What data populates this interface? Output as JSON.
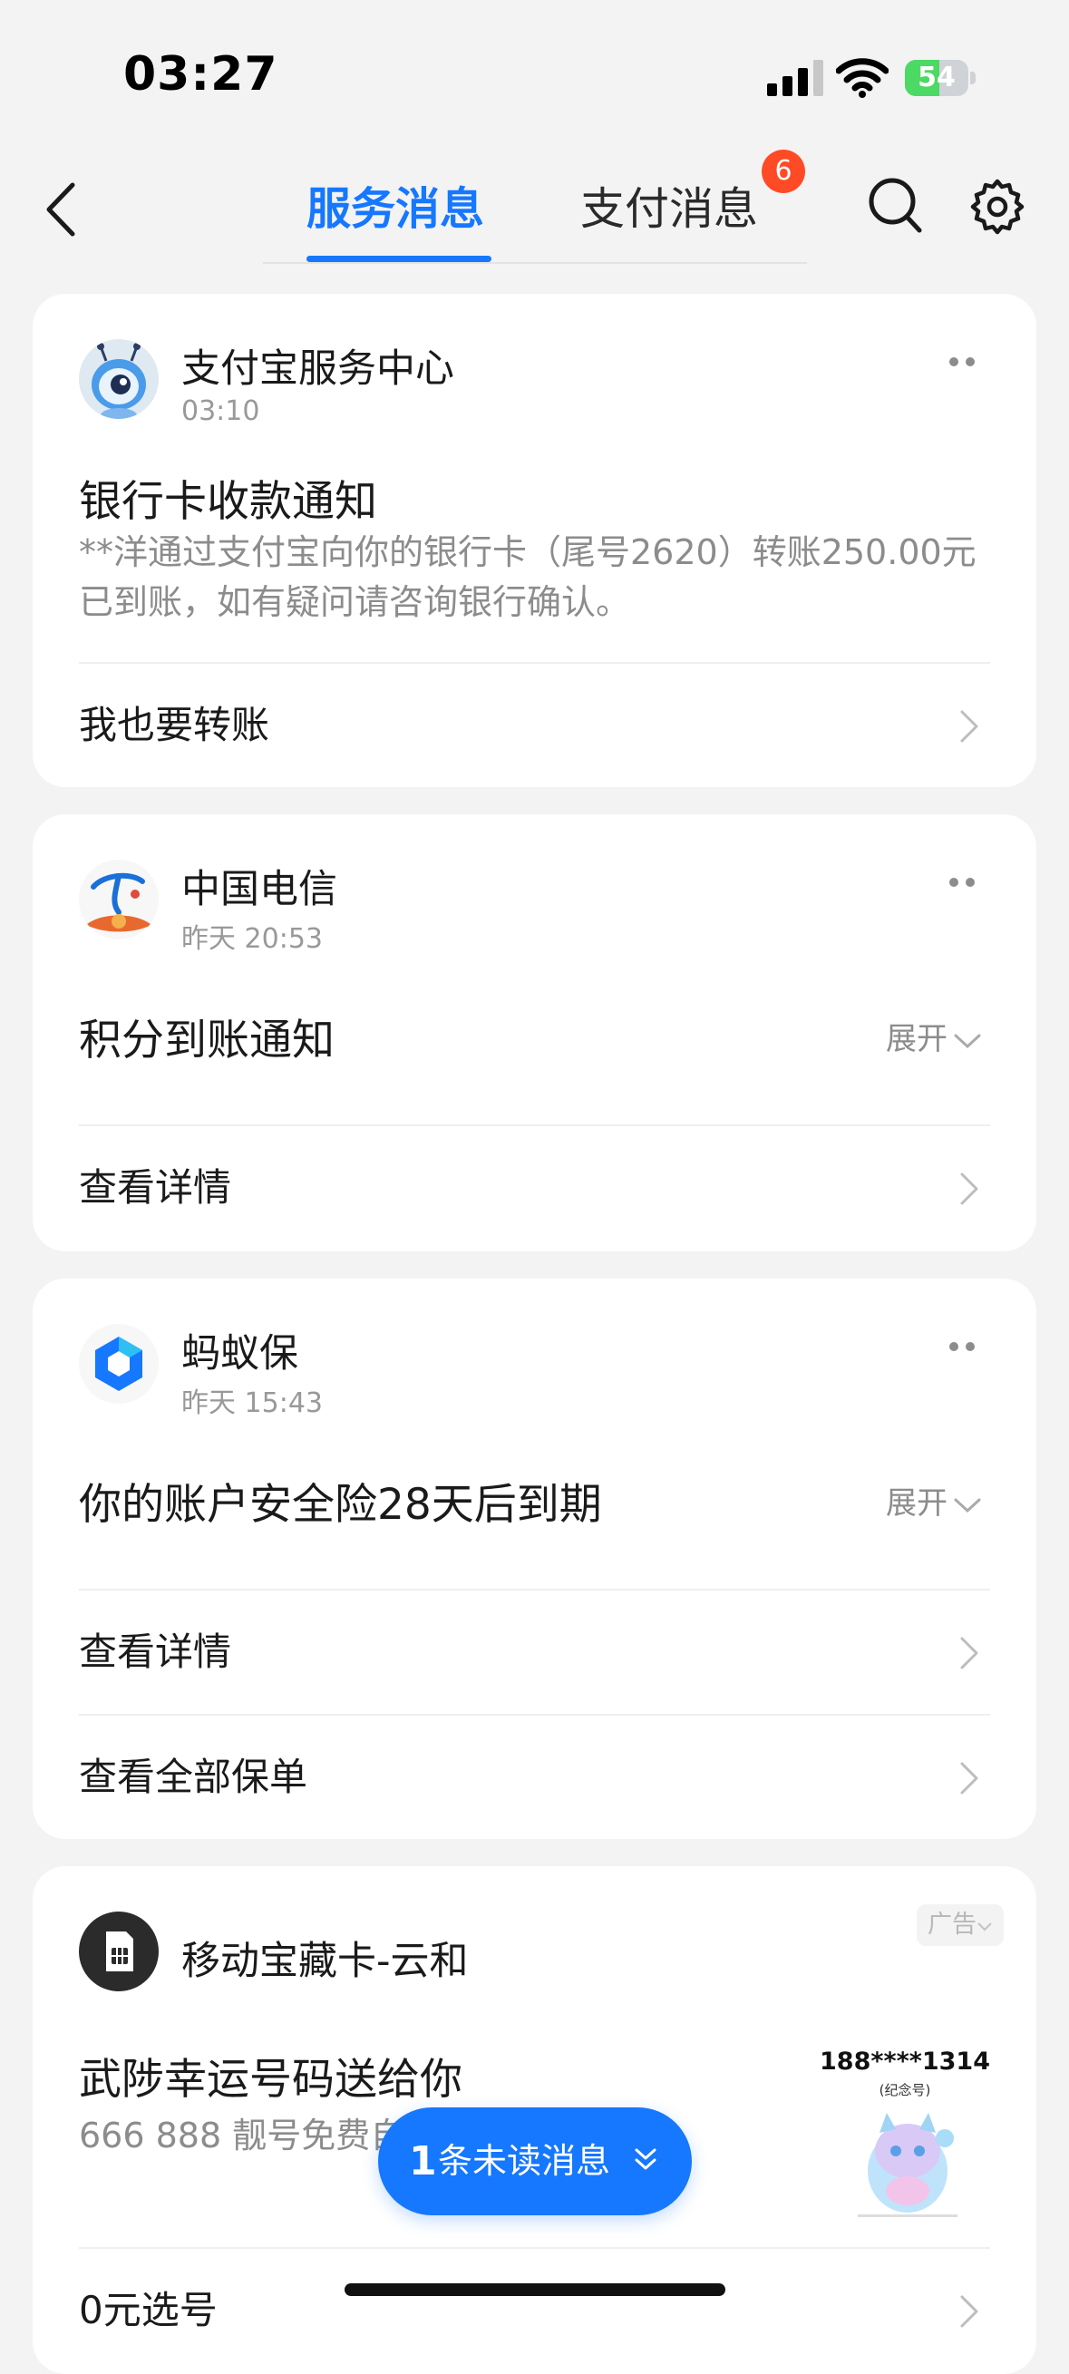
{
  "status_bar": {
    "time": "03:27",
    "battery_level": "54",
    "battery_fraction": 0.54
  },
  "nav": {
    "tabs": [
      {
        "label": "服务消息",
        "active": true
      },
      {
        "label": "支付消息",
        "active": false
      }
    ],
    "pay_badge": "6"
  },
  "colors": {
    "accent": "#1677ff",
    "badge": "#ff4a26",
    "battery": "#4cd964",
    "background": "#f3f3f3"
  },
  "cards": [
    {
      "sender": "支付宝服务中心",
      "time": "03:10",
      "title": "银行卡收款通知",
      "body": "**洋通过支付宝向你的银行卡（尾号2620）转账250.00元已到账，如有疑问请咨询银行确认。",
      "links": [
        "我也要转账"
      ]
    },
    {
      "sender": "中国电信",
      "time": "昨天 20:53",
      "title": "积分到账通知",
      "expand": "展开",
      "links": [
        "查看详情"
      ]
    },
    {
      "sender": "蚂蚁保",
      "time": "昨天 15:43",
      "title": "你的账户安全险28天后到期",
      "expand": "展开",
      "links": [
        "查看详情",
        "查看全部保单"
      ]
    },
    {
      "sender": "移动宝藏卡-云和",
      "ad_tag": "广告",
      "title": "武陟幸运号码送给你",
      "body": "666 888 靓号免费自选",
      "promo_number": "188****1314",
      "promo_caption": "(纪念号)",
      "links": [
        "0元选号"
      ]
    }
  ],
  "unread_button": {
    "count": "1",
    "label": "条未读消息"
  },
  "icons": {
    "back": "chevron-left-icon",
    "search": "search-icon",
    "settings": "gear-icon",
    "more": "more-dots-icon",
    "row_arrow": "chevron-right-icon",
    "expand": "chevron-down-icon",
    "unread": "double-chevron-down-icon"
  }
}
